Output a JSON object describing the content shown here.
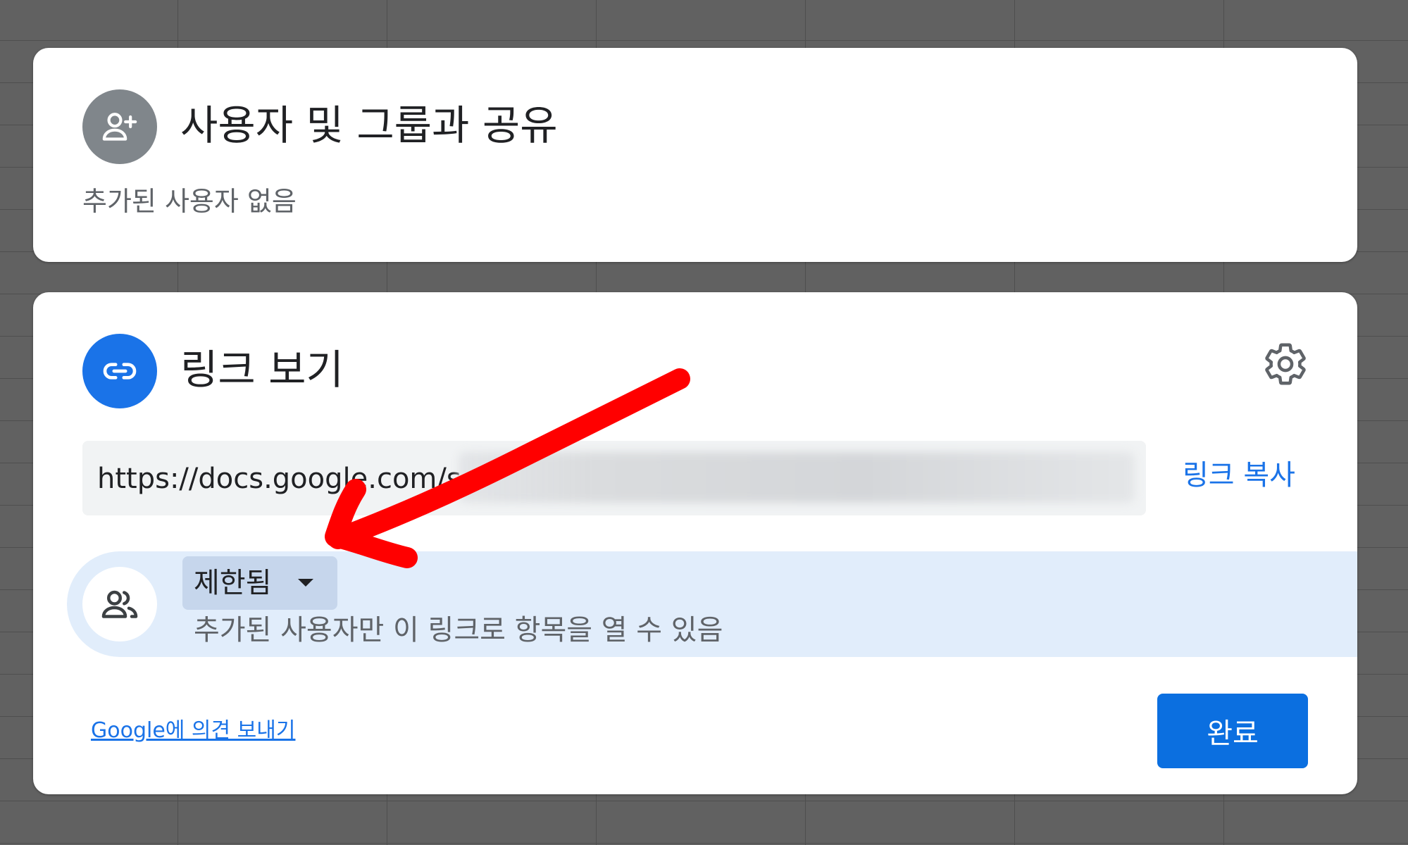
{
  "share_panel": {
    "title": "사용자 및 그룹과 공유",
    "subtitle": "추가된 사용자 없음",
    "icon": "person-add-icon"
  },
  "link_panel": {
    "title": "링크 보기",
    "icon": "link-icon",
    "settings_icon": "gear-icon",
    "url_visible": "https://docs.google.com/s",
    "url_redacted": true,
    "copy_label": "링크 복사",
    "access": {
      "icon": "people-icon",
      "selected": "제한됨",
      "description": "추가된 사용자만 이 링크로 항목을 열 수 있음"
    },
    "feedback_label": "Google에 의견 보내기",
    "done_label": "완료"
  },
  "annotation": {
    "type": "arrow",
    "color": "#ff0000",
    "points_to": "access-dropdown"
  },
  "colors": {
    "accent": "#1a73e8",
    "access_row": "#e1edfb",
    "avatar_gray": "#80868b"
  }
}
